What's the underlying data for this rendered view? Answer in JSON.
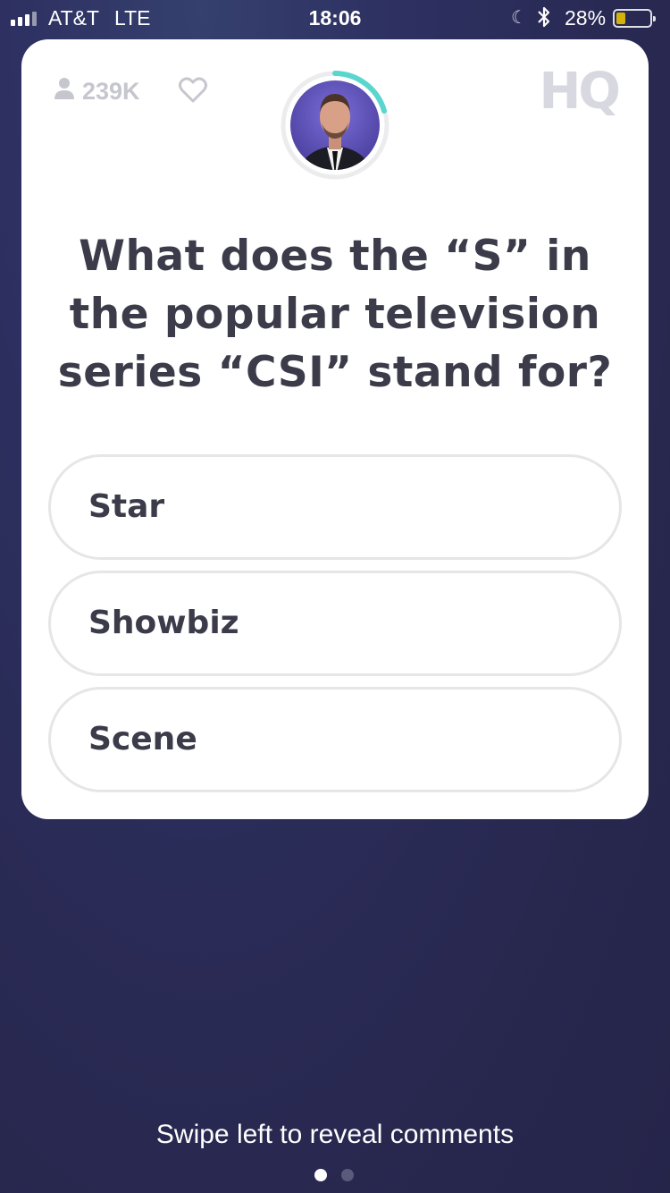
{
  "status": {
    "carrier": "AT&T",
    "network": "LTE",
    "time": "18:06",
    "battery_percent_label": "28%",
    "battery_level": 0.28,
    "battery_color": "#f4c900",
    "icons": [
      "signal-icon",
      "moon-icon",
      "bluetooth-icon",
      "battery-icon"
    ]
  },
  "header": {
    "viewer_count": "239K",
    "logo": "HQ",
    "timer_accent": "#5ad6cf"
  },
  "question": {
    "text": "What does the “S” in the popular television series “CSI” stand for?"
  },
  "answers": [
    {
      "label": "Star"
    },
    {
      "label": "Showbiz"
    },
    {
      "label": "Scene"
    }
  ],
  "footer": {
    "hint": "Swipe left to reveal comments",
    "page_indicator": {
      "current": 1,
      "total": 2
    }
  }
}
